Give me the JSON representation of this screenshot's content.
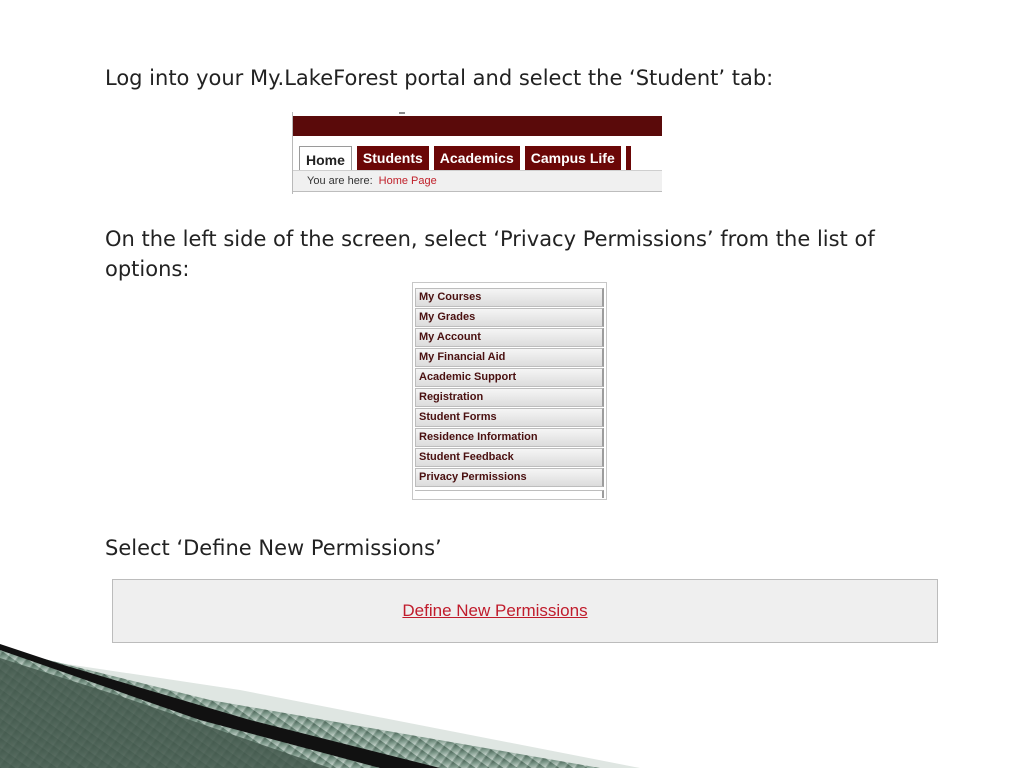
{
  "instructions": {
    "step1": "Log into your My.LakeForest portal and select the ‘Student’ tab:",
    "step2": "On the left side of the screen, select ‘Privacy Permissions’ from the list of options:",
    "step3": "Select ‘Define New Permissions’"
  },
  "portal": {
    "tabs": [
      {
        "label": "Home",
        "active": true
      },
      {
        "label": "Students",
        "active": false
      },
      {
        "label": "Academics",
        "active": false
      },
      {
        "label": "Campus Life",
        "active": false
      }
    ],
    "breadcrumb_label": "You are here:",
    "breadcrumb_link": "Home Page"
  },
  "menu": {
    "items": [
      "My Courses",
      "My Grades",
      "My Account",
      "My Financial Aid",
      "Academic Support",
      "Registration",
      "Student Forms",
      "Residence Information",
      "Student Feedback",
      "Privacy Permissions"
    ]
  },
  "define": {
    "link_label": "Define New Permissions"
  },
  "colors": {
    "portal_banner": "#5a0a0a",
    "portal_tab": "#6b0707",
    "link_red": "#c01c2c",
    "decor_green": "#4f6b5c"
  }
}
